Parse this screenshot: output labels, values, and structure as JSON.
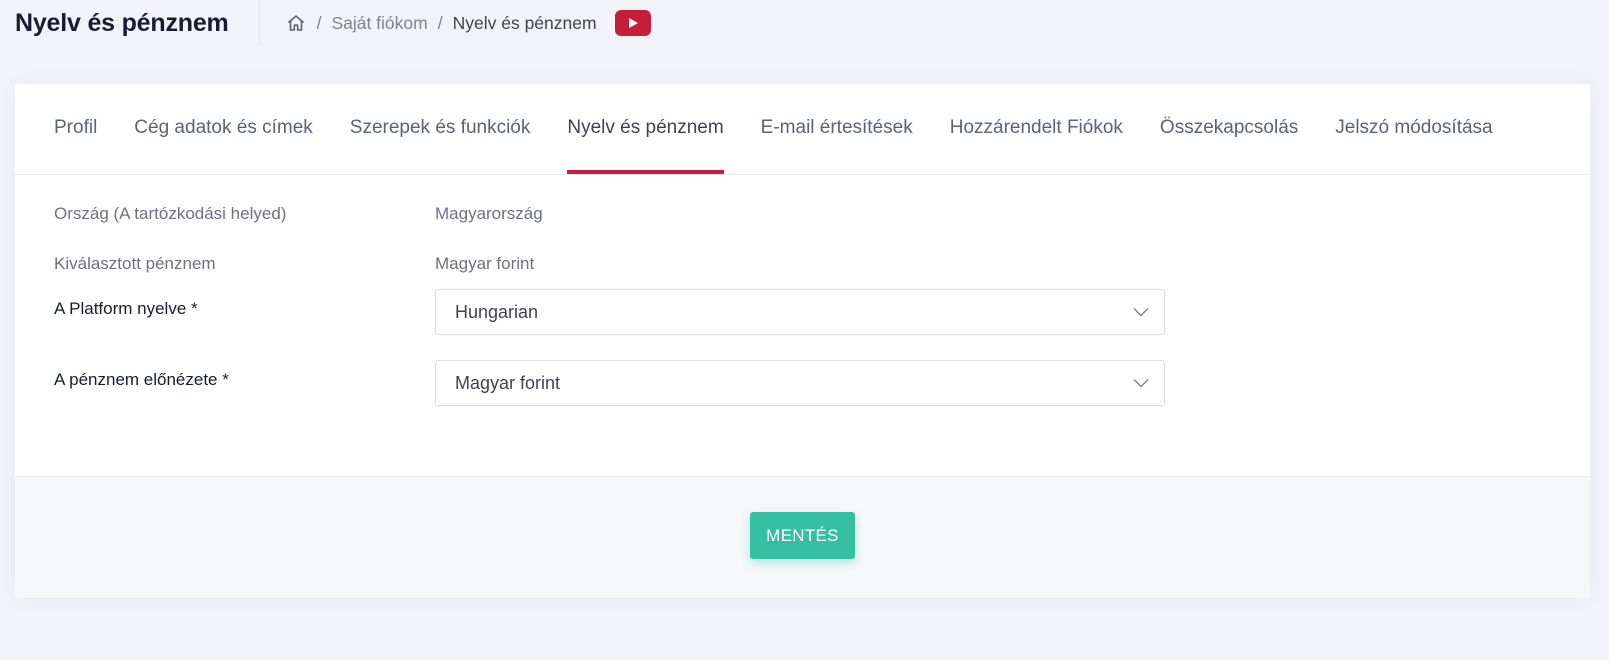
{
  "header": {
    "title": "Nyelv és pénznem",
    "breadcrumb": {
      "separator": "/",
      "items": [
        "Saját fiókom",
        "Nyelv és pénznem"
      ]
    }
  },
  "tabs": [
    {
      "label": "Profil",
      "active": false
    },
    {
      "label": "Cég adatok és címek",
      "active": false
    },
    {
      "label": "Szerepek és funkciók",
      "active": false
    },
    {
      "label": "Nyelv és pénznem",
      "active": true
    },
    {
      "label": "E-mail értesítések",
      "active": false
    },
    {
      "label": "Hozzárendelt Fiókok",
      "active": false
    },
    {
      "label": "Összekapcsolás",
      "active": false
    },
    {
      "label": "Jelszó módosítása",
      "active": false
    }
  ],
  "form": {
    "country": {
      "label": "Ország (A tartózkodási helyed)",
      "value": "Magyarország"
    },
    "selected_currency": {
      "label": "Kiválasztott pénznem",
      "value": "Magyar forint"
    },
    "platform_language": {
      "label": "A Platform nyelve *",
      "value": "Hungarian"
    },
    "currency_preview": {
      "label": "A pénznem előnézete *",
      "value": "Magyar forint"
    }
  },
  "actions": {
    "save_label": "MENTÉS"
  },
  "colors": {
    "accent": "#c41e3a",
    "save_button": "#34bfa3",
    "background": "#f2f3f8"
  },
  "icons": {
    "home": "home-icon",
    "video": "youtube-icon",
    "select_chevron": "chevron-down-icon"
  }
}
